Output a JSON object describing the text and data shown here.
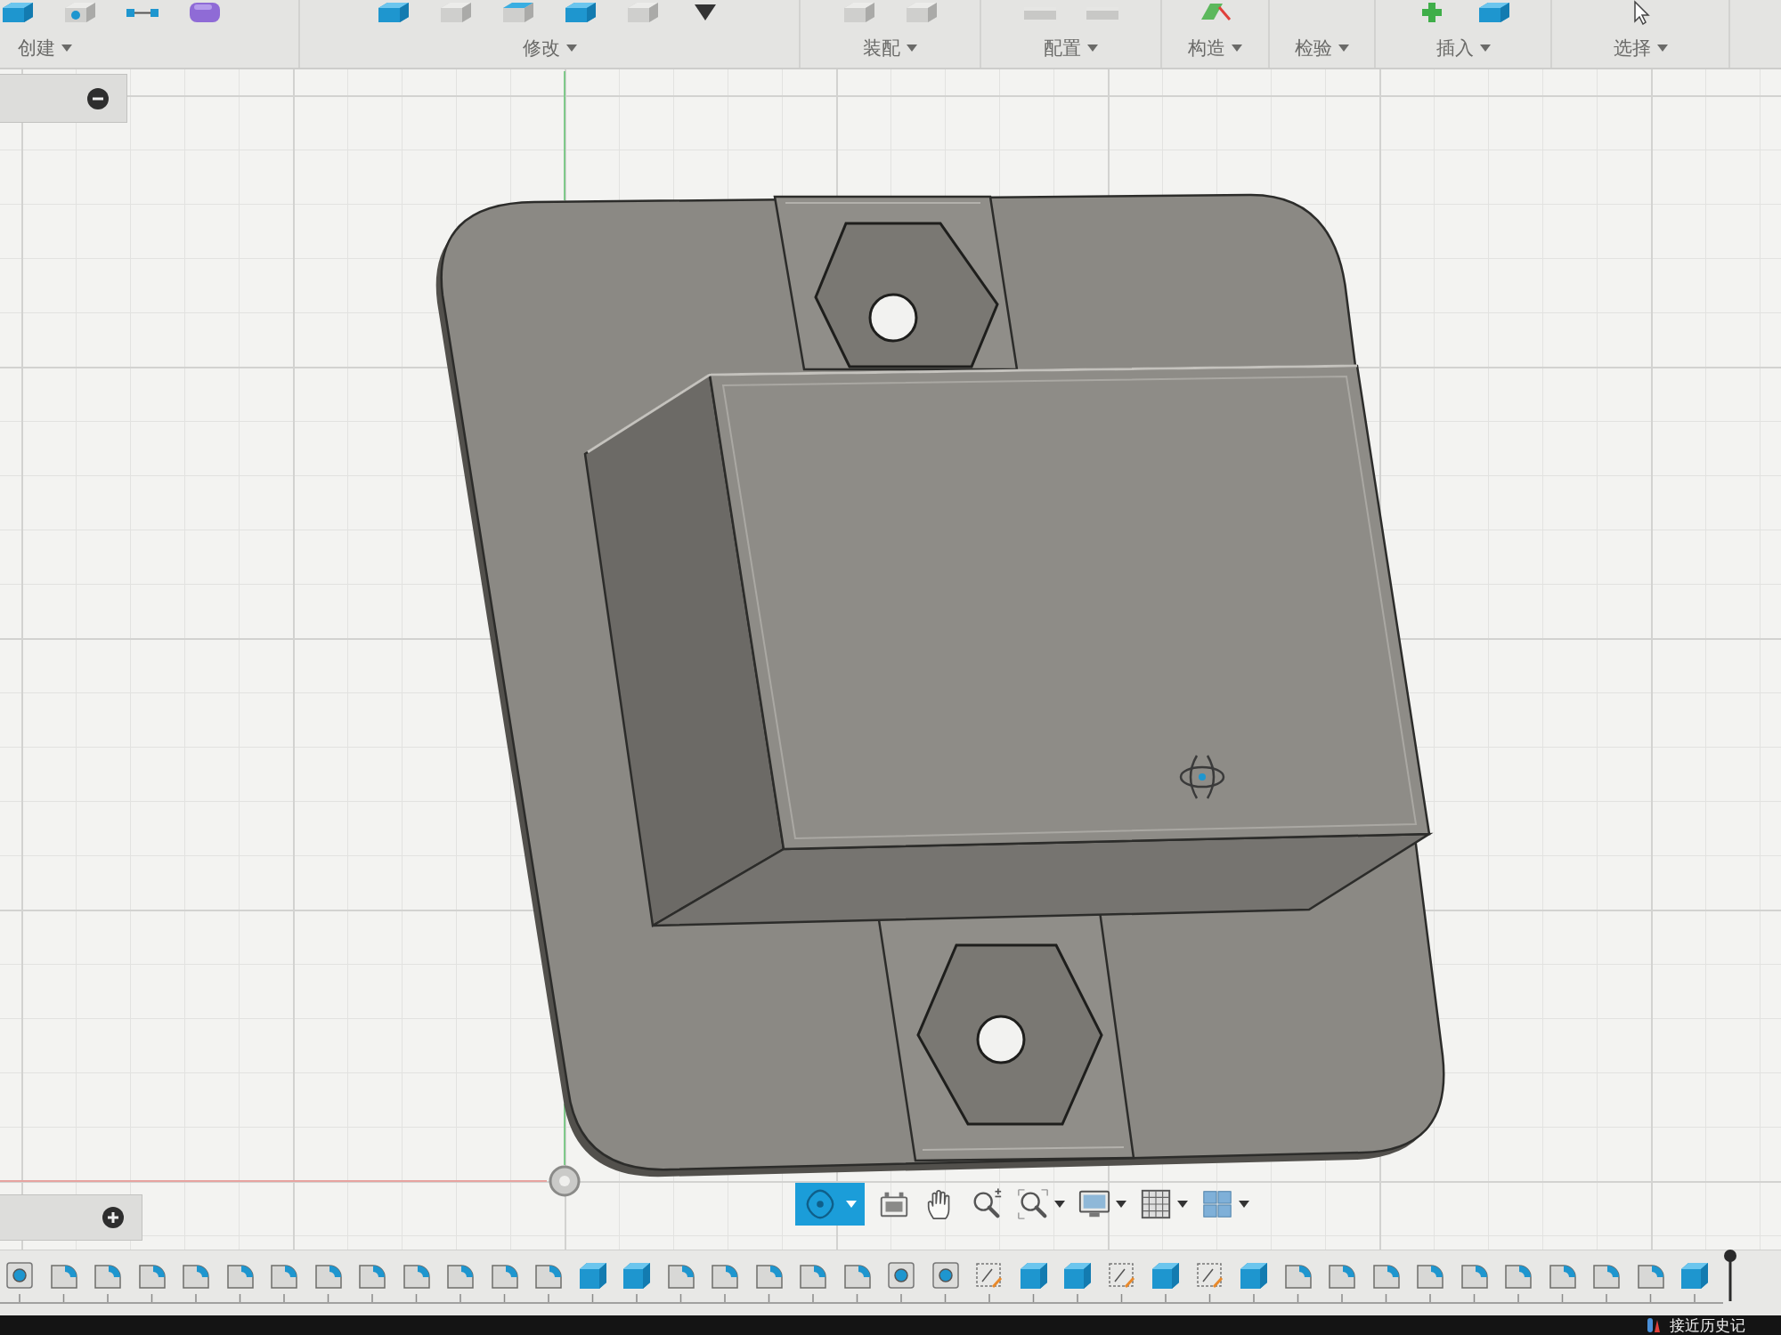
{
  "toolbar": {
    "groups": [
      {
        "label": "创建"
      },
      {
        "label": "修改"
      },
      {
        "label": "装配"
      },
      {
        "label": "配置"
      },
      {
        "label": "构造"
      },
      {
        "label": "检验"
      },
      {
        "label": "插入"
      },
      {
        "label": "选择"
      }
    ]
  },
  "navigation_bar": {
    "tools": [
      {
        "kind": "orbit",
        "selected": true,
        "dropdown": true
      },
      {
        "kind": "look_at",
        "selected": false,
        "dropdown": false
      },
      {
        "kind": "pan",
        "selected": false,
        "dropdown": false
      },
      {
        "kind": "zoom",
        "selected": false,
        "dropdown": false
      },
      {
        "kind": "fit",
        "selected": false,
        "dropdown": true
      },
      {
        "kind": "display",
        "selected": false,
        "dropdown": true
      },
      {
        "kind": "grid",
        "selected": false,
        "dropdown": true
      },
      {
        "kind": "viewports",
        "selected": false,
        "dropdown": true
      }
    ]
  },
  "timeline": {
    "items": [
      {
        "kind": "hole"
      },
      {
        "kind": "fillet"
      },
      {
        "kind": "fillet"
      },
      {
        "kind": "fillet"
      },
      {
        "kind": "fillet"
      },
      {
        "kind": "fillet"
      },
      {
        "kind": "fillet"
      },
      {
        "kind": "fillet"
      },
      {
        "kind": "fillet"
      },
      {
        "kind": "fillet"
      },
      {
        "kind": "fillet"
      },
      {
        "kind": "fillet"
      },
      {
        "kind": "fillet"
      },
      {
        "kind": "extrude"
      },
      {
        "kind": "extrude"
      },
      {
        "kind": "fillet"
      },
      {
        "kind": "fillet"
      },
      {
        "kind": "fillet"
      },
      {
        "kind": "fillet"
      },
      {
        "kind": "fillet"
      },
      {
        "kind": "hole"
      },
      {
        "kind": "hole"
      },
      {
        "kind": "sketch"
      },
      {
        "kind": "extrude"
      },
      {
        "kind": "extrude"
      },
      {
        "kind": "sketch"
      },
      {
        "kind": "extrude"
      },
      {
        "kind": "sketch"
      },
      {
        "kind": "extrude"
      },
      {
        "kind": "fillet"
      },
      {
        "kind": "fillet"
      },
      {
        "kind": "fillet"
      },
      {
        "kind": "fillet"
      },
      {
        "kind": "fillet"
      },
      {
        "kind": "fillet"
      },
      {
        "kind": "fillet"
      },
      {
        "kind": "fillet"
      },
      {
        "kind": "fillet"
      },
      {
        "kind": "extrude"
      }
    ]
  },
  "taskbar": {
    "label": "接近历史记"
  }
}
